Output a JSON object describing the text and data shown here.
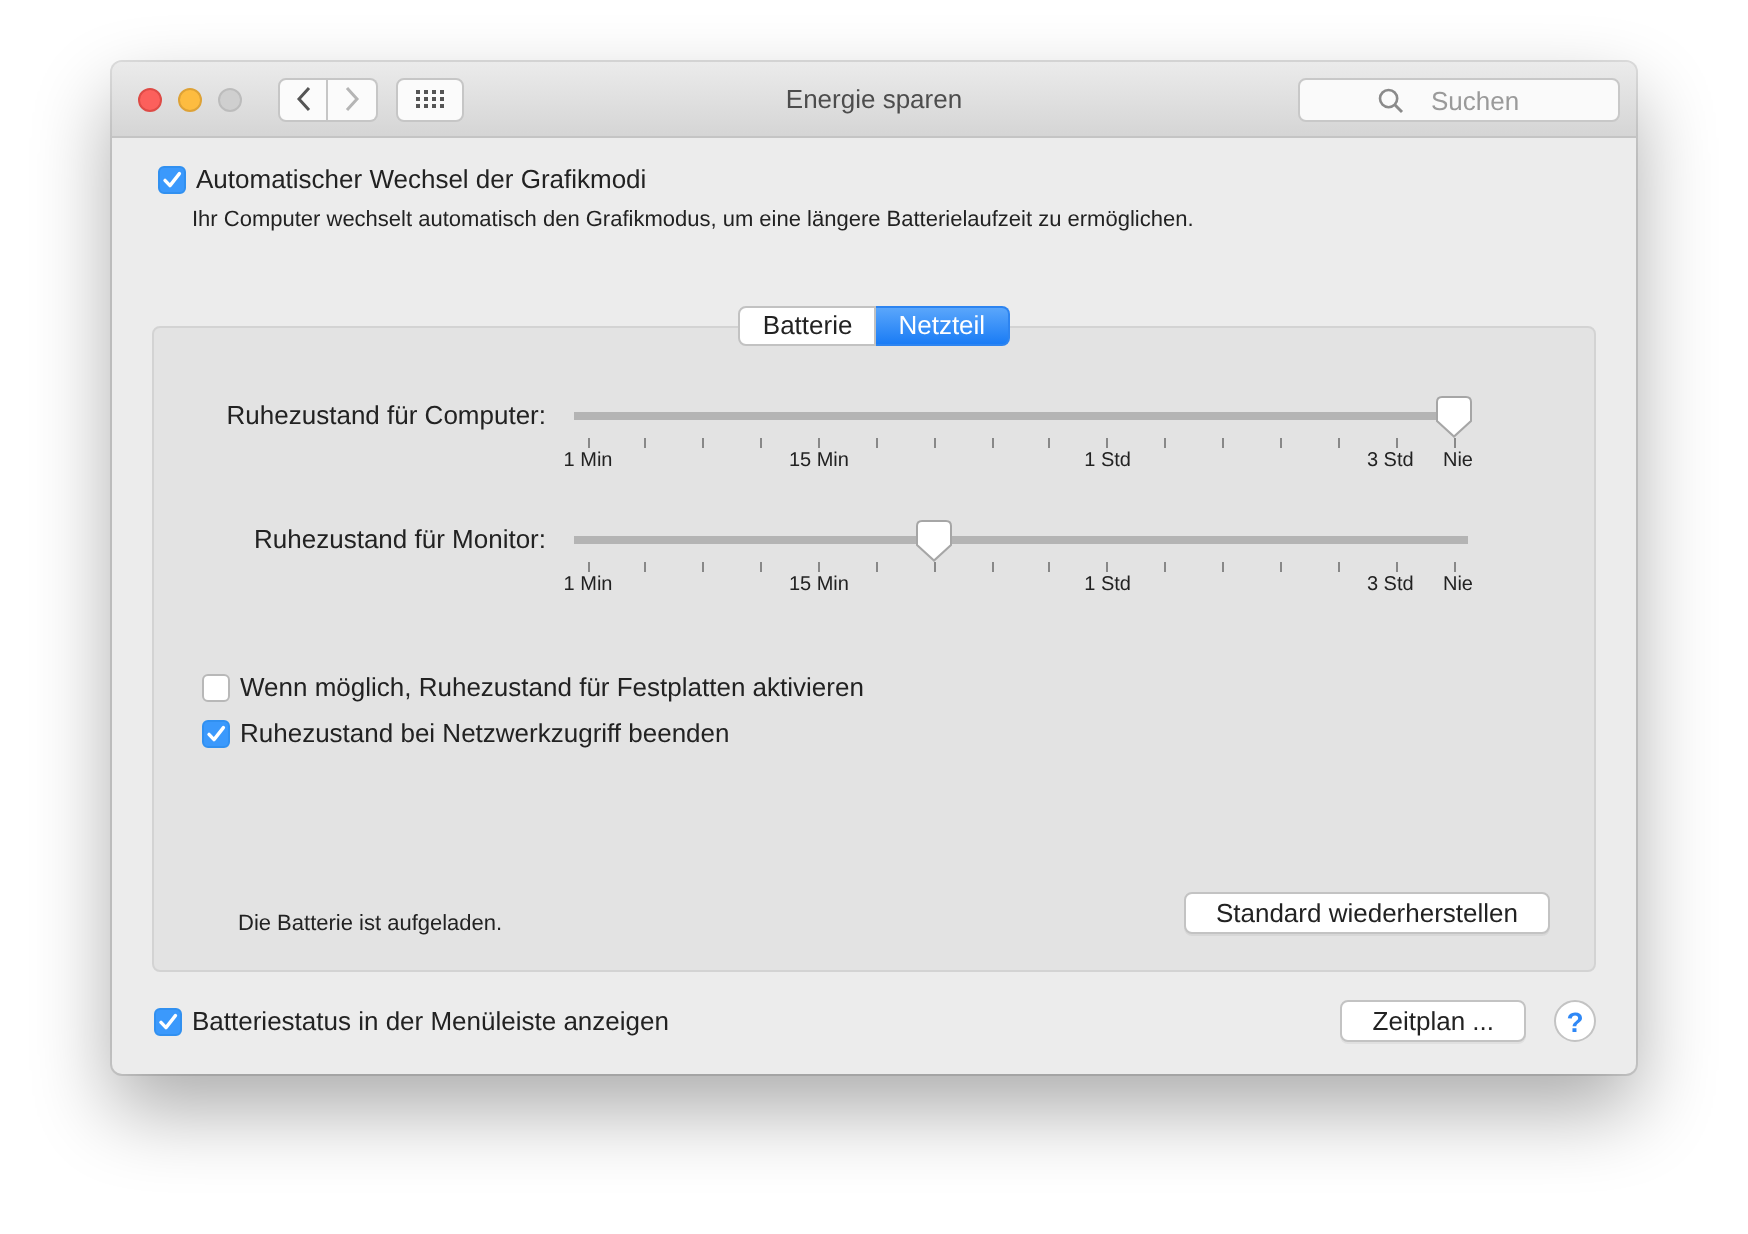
{
  "window": {
    "title": "Energie sparen"
  },
  "search": {
    "placeholder": "Suchen"
  },
  "graphics_switching": {
    "label": "Automatischer Wechsel der Grafikmodi",
    "checked": true,
    "description": "Ihr Computer wechselt automatisch den Grafikmodus, um eine längere Batterielaufzeit zu ermöglichen."
  },
  "tabs": [
    {
      "label": "Batterie",
      "selected": false
    },
    {
      "label": "Netzteil",
      "selected": true
    }
  ],
  "sliders": [
    {
      "label": "Ruhezustand für Computer:",
      "level": 1.0,
      "ticks": [
        "1 Min",
        "15 Min",
        "1 Std",
        "3 Std",
        "Nie"
      ]
    },
    {
      "label": "Ruhezustand für Monitor:",
      "level": 0.4,
      "ticks": [
        "1 Min",
        "15 Min",
        "1 Std",
        "3 Std",
        "Nie"
      ]
    }
  ],
  "options": [
    {
      "label": "Wenn möglich, Ruhezustand für Festplatten aktivieren",
      "checked": false
    },
    {
      "label": "Ruhezustand bei Netzwerkzugriff beenden",
      "checked": true
    }
  ],
  "status": "Die Batterie ist aufgeladen.",
  "restore_button": "Standard wiederherstellen",
  "menu_bar_status": {
    "label": "Batteriestatus in der Menüleiste anzeigen",
    "checked": true
  },
  "schedule_button": "Zeitplan ...",
  "help_button": "?"
}
